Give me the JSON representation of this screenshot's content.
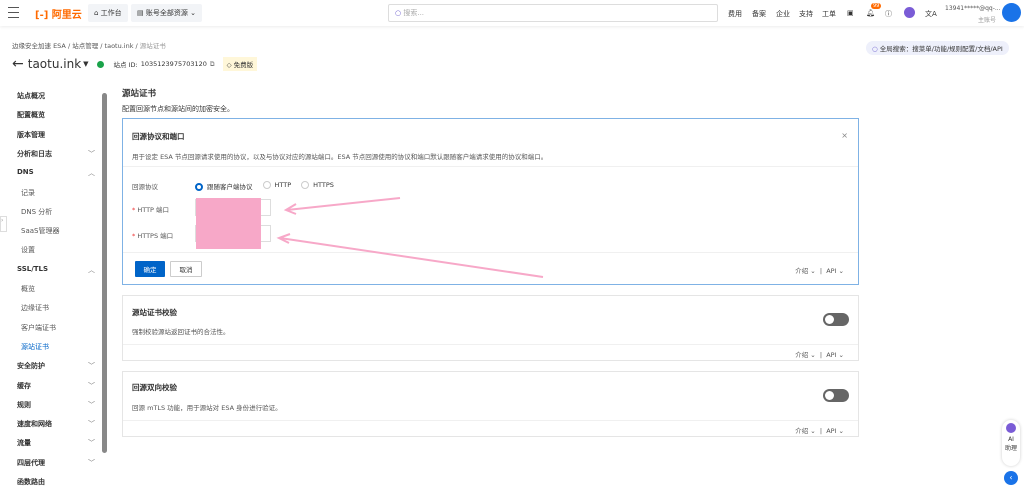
{
  "topbar": {
    "logo": "阿里云",
    "workbench": "工作台",
    "resources": "账号全部资源",
    "search_placeholder": "搜索...",
    "nav": [
      "费用",
      "备案",
      "企业",
      "支持",
      "工单"
    ],
    "notification_count": "99",
    "account": "13941*****@qq-...",
    "account_role": "主账号"
  },
  "breadcrumb": [
    "边缘安全加速 ESA",
    "站点管理",
    "taotu.ink",
    "源站证书"
  ],
  "site": {
    "name": "taotu.ink",
    "id_label": "站点 ID:",
    "id": "1035123975703120",
    "plan": "免费版",
    "status_color": "#1aa34a"
  },
  "global_search": "全局搜索：搜菜单/功能/规则配置/文档/API",
  "sidebar": {
    "items": [
      {
        "label": "站点概况",
        "level": 1
      },
      {
        "label": "配置概览",
        "level": 1
      },
      {
        "label": "版本管理",
        "level": 1
      },
      {
        "label": "分析和日志",
        "level": 1,
        "chevron": "down"
      },
      {
        "label": "DNS",
        "level": 1,
        "chevron": "up"
      },
      {
        "label": "记录",
        "level": 2
      },
      {
        "label": "DNS 分析",
        "level": 2
      },
      {
        "label": "SaaS管理器",
        "level": 2
      },
      {
        "label": "设置",
        "level": 2
      },
      {
        "label": "SSL/TLS",
        "level": 1,
        "chevron": "up"
      },
      {
        "label": "概览",
        "level": 2
      },
      {
        "label": "边缘证书",
        "level": 2
      },
      {
        "label": "客户端证书",
        "level": 2
      },
      {
        "label": "源站证书",
        "level": 2,
        "active": true
      },
      {
        "label": "安全防护",
        "level": 1,
        "chevron": "down"
      },
      {
        "label": "缓存",
        "level": 1,
        "chevron": "down"
      },
      {
        "label": "规则",
        "level": 1,
        "chevron": "down"
      },
      {
        "label": "速度和网络",
        "level": 1,
        "chevron": "down"
      },
      {
        "label": "流量",
        "level": 1,
        "chevron": "down"
      },
      {
        "label": "四层代理",
        "level": 1,
        "chevron": "down"
      },
      {
        "label": "函数路由",
        "level": 1
      }
    ]
  },
  "page": {
    "title": "源站证书",
    "subtitle": "配置回源节点和源站间的加密安全。"
  },
  "card1": {
    "title": "回源协议和端口",
    "desc": "用于设定 ESA 节点回源请求使用的协议，以及与协议对应的源站端口。ESA 节点回源使用的协议和端口默认跟随客户端请求使用的协议和端口。",
    "protocol_label": "回源协议",
    "options": [
      "跟随客户端协议",
      "HTTP",
      "HTTPS"
    ],
    "selected": "跟随客户端协议",
    "http_port_label": "HTTP 端口",
    "https_port_label": "HTTPS 端口",
    "ok": "确定",
    "cancel": "取消",
    "intro": "介绍",
    "api": "API"
  },
  "card2": {
    "title": "源站证书校验",
    "desc": "强制校验源站返回证书的合法性。",
    "enabled": false,
    "intro": "介绍",
    "api": "API"
  },
  "card3": {
    "title": "回源双向校验",
    "desc": "回源 mTLS 功能，用于源站对 ESA 身份进行验证。",
    "enabled": false,
    "intro": "介绍",
    "api": "API"
  },
  "assistant": {
    "label1": "AI",
    "label2": "助理"
  },
  "accent": "#0064c8",
  "annotation_color": "#f7a8c8"
}
